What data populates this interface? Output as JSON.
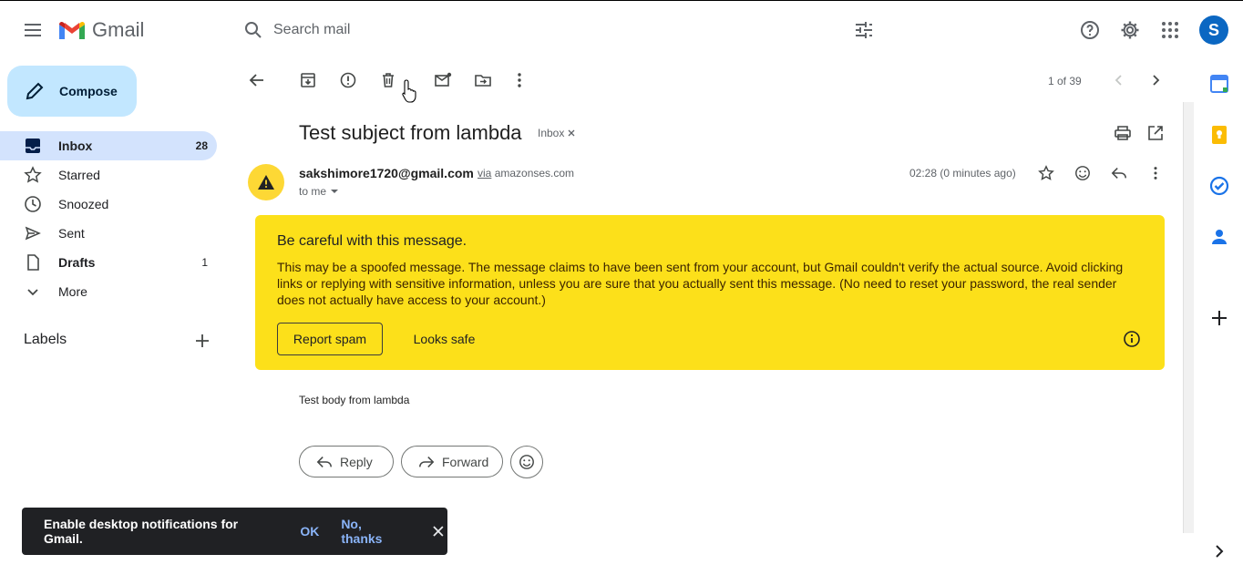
{
  "header": {
    "app_name": "Gmail",
    "search_placeholder": "Search mail",
    "avatar_letter": "S"
  },
  "sidebar": {
    "compose_label": "Compose",
    "items": [
      {
        "label": "Inbox",
        "count": "28",
        "icon": "inbox-icon"
      },
      {
        "label": "Starred",
        "count": "",
        "icon": "star-icon"
      },
      {
        "label": "Snoozed",
        "count": "",
        "icon": "clock-icon"
      },
      {
        "label": "Sent",
        "count": "",
        "icon": "send-icon"
      },
      {
        "label": "Drafts",
        "count": "1",
        "icon": "draft-icon"
      },
      {
        "label": "More",
        "count": "",
        "icon": "chevron-down-icon"
      }
    ],
    "labels_title": "Labels"
  },
  "toolbar": {
    "pagination": "1 of 39"
  },
  "message": {
    "subject": "Test subject from lambda",
    "label_chip": "Inbox",
    "sender_email": "sakshimore1720@gmail.com",
    "via_word": "via",
    "via_domain": "amazonses.com",
    "recipient": "to me",
    "timestamp": "02:28 (0 minutes ago)",
    "body": "Test body from lambda"
  },
  "warning": {
    "title": "Be careful with this message.",
    "body": "This may be a spoofed message. The message claims to have been sent from your account, but Gmail couldn't verify the actual source. Avoid clicking links or replying with sensitive information, unless you are sure that you actually sent this message. (No need to reset your password, the real sender does not actually have access to your account.)",
    "report_label": "Report spam",
    "safe_label": "Looks safe",
    "background": "#fce01a"
  },
  "actions": {
    "reply_label": "Reply",
    "forward_label": "Forward"
  },
  "snackbar": {
    "text": "Enable desktop notifications for Gmail.",
    "ok_label": "OK",
    "no_label": "No, thanks"
  },
  "colors": {
    "compose_bg": "#c2e7ff",
    "active_nav_bg": "#d3e3fd",
    "avatar_bg": "#0b67c2",
    "snackbar_bg": "#202124",
    "snackbar_link": "#8ab4f8"
  }
}
